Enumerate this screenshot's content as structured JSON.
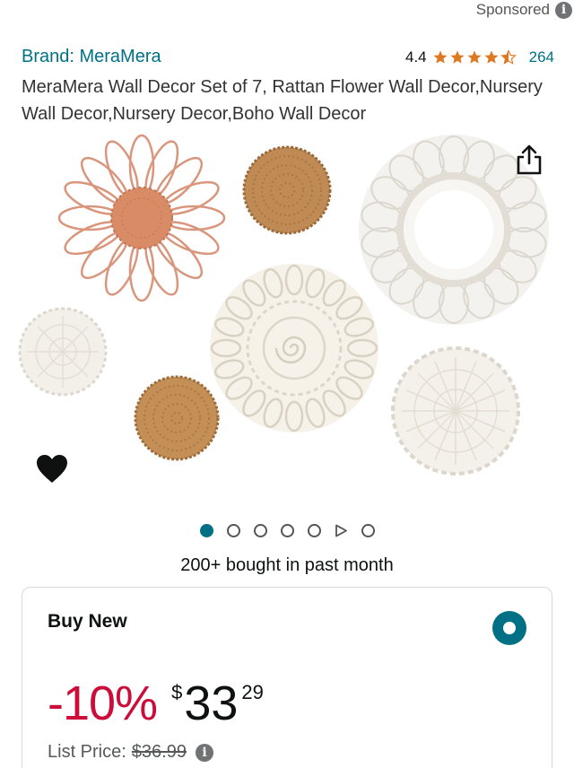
{
  "sponsored": {
    "label": "Sponsored",
    "icon": "info-icon"
  },
  "product": {
    "brand": "Brand: MeraMera",
    "rating": "4.4",
    "rating_stars": 4.4,
    "rating_count": "264",
    "title": "MeraMera Wall Decor Set of 7, Rattan Flower Wall Decor,Nursery Wall Decor,Nursery Decor,Boho Wall Decor"
  },
  "gallery": {
    "image_count": 7,
    "active_index": 0,
    "video_index": 5
  },
  "social_proof": "200+ bought in past month",
  "buy_box": {
    "title": "Buy New",
    "discount": "-10%",
    "currency": "$",
    "price_whole": "33",
    "price_fraction": "29",
    "list_price_label": "List Price:",
    "list_price": "$36.99"
  },
  "colors": {
    "link": "#007185",
    "discount": "#cc0c39",
    "star": "#de7921"
  }
}
